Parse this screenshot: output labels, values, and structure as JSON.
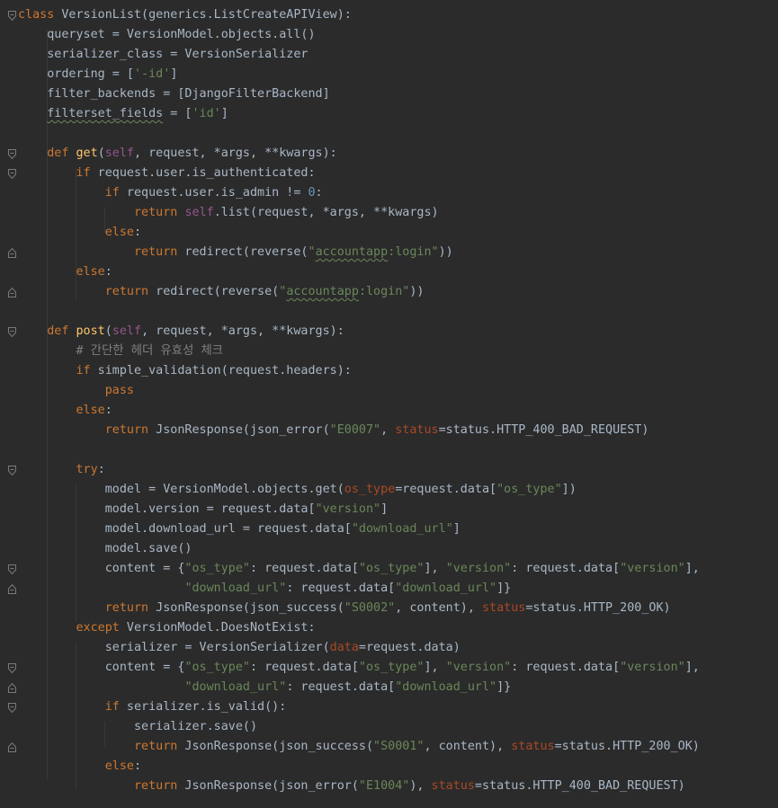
{
  "editor": {
    "language": "python",
    "theme": "darcula",
    "colors": {
      "background": "#2b2b2b",
      "keyword": "#cc7832",
      "function": "#ffc66d",
      "self": "#94558d",
      "string": "#6a8759",
      "number": "#6897bb",
      "comment": "#808080",
      "param": "#aa4926",
      "default": "#a9b7c6"
    },
    "lines": [
      [
        {
          "t": "class",
          "c": "kw"
        },
        {
          "t": " VersionList(generics.ListCreateAPIView):"
        }
      ],
      [
        {
          "t": "    queryset = VersionModel.objects.all()"
        }
      ],
      [
        {
          "t": "    serializer_class = VersionSerializer"
        }
      ],
      [
        {
          "t": "    ordering = ["
        },
        {
          "t": "'-id'",
          "c": "str"
        },
        {
          "t": "]"
        }
      ],
      [
        {
          "t": "    filter_backends = [DjangoFilterBackend]"
        }
      ],
      [
        {
          "t": "    "
        },
        {
          "t": "filterset_fields",
          "c": "wavy-g"
        },
        {
          "t": " = ["
        },
        {
          "t": "'id'",
          "c": "str"
        },
        {
          "t": "]"
        }
      ],
      [],
      [
        {
          "t": "    "
        },
        {
          "t": "def",
          "c": "kw"
        },
        {
          "t": " "
        },
        {
          "t": "get",
          "c": "fn"
        },
        {
          "t": "("
        },
        {
          "t": "self",
          "c": "slf"
        },
        {
          "t": ", request, *args, **kwargs):"
        }
      ],
      [
        {
          "t": "        "
        },
        {
          "t": "if",
          "c": "kw"
        },
        {
          "t": " request.user.is_authenticated:"
        }
      ],
      [
        {
          "t": "            "
        },
        {
          "t": "if",
          "c": "kw"
        },
        {
          "t": " request.user.is_admin != "
        },
        {
          "t": "0",
          "c": "num"
        },
        {
          "t": ":"
        }
      ],
      [
        {
          "t": "                "
        },
        {
          "t": "return",
          "c": "kw"
        },
        {
          "t": " "
        },
        {
          "t": "self",
          "c": "slf"
        },
        {
          "t": ".list(request, *args, **kwargs)"
        }
      ],
      [
        {
          "t": "            "
        },
        {
          "t": "else",
          "c": "kw"
        },
        {
          "t": ":"
        }
      ],
      [
        {
          "t": "                "
        },
        {
          "t": "return",
          "c": "kw"
        },
        {
          "t": " redirect(reverse("
        },
        {
          "t": "\"",
          "c": "str"
        },
        {
          "t": "accountapp",
          "c": "str wavy"
        },
        {
          "t": ":login\"",
          "c": "str"
        },
        {
          "t": "))"
        }
      ],
      [
        {
          "t": "        "
        },
        {
          "t": "else",
          "c": "kw"
        },
        {
          "t": ":"
        }
      ],
      [
        {
          "t": "            "
        },
        {
          "t": "return",
          "c": "kw"
        },
        {
          "t": " redirect(reverse("
        },
        {
          "t": "\"",
          "c": "str"
        },
        {
          "t": "accountapp",
          "c": "str wavy"
        },
        {
          "t": ":login\"",
          "c": "str"
        },
        {
          "t": "))"
        }
      ],
      [],
      [
        {
          "t": "    "
        },
        {
          "t": "def",
          "c": "kw"
        },
        {
          "t": " "
        },
        {
          "t": "post",
          "c": "fn"
        },
        {
          "t": "("
        },
        {
          "t": "self",
          "c": "slf"
        },
        {
          "t": ", request, *args, **kwargs):"
        }
      ],
      [
        {
          "t": "        "
        },
        {
          "t": "# 간단한 헤더 유효성 체크",
          "c": "cm"
        }
      ],
      [
        {
          "t": "        "
        },
        {
          "t": "if",
          "c": "kw"
        },
        {
          "t": " simple_validation(request.headers):"
        }
      ],
      [
        {
          "t": "            "
        },
        {
          "t": "pass",
          "c": "kw"
        }
      ],
      [
        {
          "t": "        "
        },
        {
          "t": "else",
          "c": "kw"
        },
        {
          "t": ":"
        }
      ],
      [
        {
          "t": "            "
        },
        {
          "t": "return",
          "c": "kw"
        },
        {
          "t": " JsonResponse(json_error("
        },
        {
          "t": "\"E0007\"",
          "c": "str"
        },
        {
          "t": ", "
        },
        {
          "t": "status",
          "c": "prm"
        },
        {
          "t": "=status.HTTP_400_BAD_REQUEST)"
        }
      ],
      [],
      [
        {
          "t": "        "
        },
        {
          "t": "try",
          "c": "kw"
        },
        {
          "t": ":"
        }
      ],
      [
        {
          "t": "            model = VersionModel.objects.get("
        },
        {
          "t": "os_type",
          "c": "prm"
        },
        {
          "t": "=request.data["
        },
        {
          "t": "\"os_type\"",
          "c": "str"
        },
        {
          "t": "])"
        }
      ],
      [
        {
          "t": "            model.version = request.data["
        },
        {
          "t": "\"version\"",
          "c": "str"
        },
        {
          "t": "]"
        }
      ],
      [
        {
          "t": "            model.download_url = request.data["
        },
        {
          "t": "\"download_url\"",
          "c": "str"
        },
        {
          "t": "]"
        }
      ],
      [
        {
          "t": "            model.save()"
        }
      ],
      [
        {
          "t": "            content = {"
        },
        {
          "t": "\"os_type\"",
          "c": "str"
        },
        {
          "t": ": request.data["
        },
        {
          "t": "\"os_type\"",
          "c": "str"
        },
        {
          "t": "], "
        },
        {
          "t": "\"version\"",
          "c": "str"
        },
        {
          "t": ": request.data["
        },
        {
          "t": "\"version\"",
          "c": "str"
        },
        {
          "t": "],"
        }
      ],
      [
        {
          "t": "                       "
        },
        {
          "t": "\"download_url\"",
          "c": "str"
        },
        {
          "t": ": request.data["
        },
        {
          "t": "\"download_url\"",
          "c": "str"
        },
        {
          "t": "]}"
        }
      ],
      [
        {
          "t": "            "
        },
        {
          "t": "return",
          "c": "kw"
        },
        {
          "t": " JsonResponse(json_success("
        },
        {
          "t": "\"S0002\"",
          "c": "str"
        },
        {
          "t": ", content), "
        },
        {
          "t": "status",
          "c": "prm"
        },
        {
          "t": "=status.HTTP_200_OK)"
        }
      ],
      [
        {
          "t": "        "
        },
        {
          "t": "except",
          "c": "kw"
        },
        {
          "t": " VersionModel.DoesNotExist:"
        }
      ],
      [
        {
          "t": "            serializer = VersionSerializer("
        },
        {
          "t": "data",
          "c": "prm"
        },
        {
          "t": "=request.data)"
        }
      ],
      [
        {
          "t": "            content = {"
        },
        {
          "t": "\"os_type\"",
          "c": "str"
        },
        {
          "t": ": request.data["
        },
        {
          "t": "\"os_type\"",
          "c": "str"
        },
        {
          "t": "], "
        },
        {
          "t": "\"version\"",
          "c": "str"
        },
        {
          "t": ": request.data["
        },
        {
          "t": "\"version\"",
          "c": "str"
        },
        {
          "t": "],"
        }
      ],
      [
        {
          "t": "                       "
        },
        {
          "t": "\"download_url\"",
          "c": "str"
        },
        {
          "t": ": request.data["
        },
        {
          "t": "\"download_url\"",
          "c": "str"
        },
        {
          "t": "]}"
        }
      ],
      [
        {
          "t": "            "
        },
        {
          "t": "if",
          "c": "kw"
        },
        {
          "t": " serializer.is_valid():"
        }
      ],
      [
        {
          "t": "                serializer.save()"
        }
      ],
      [
        {
          "t": "                "
        },
        {
          "t": "return",
          "c": "kw"
        },
        {
          "t": " JsonResponse(json_success("
        },
        {
          "t": "\"S0001\"",
          "c": "str"
        },
        {
          "t": ", content), "
        },
        {
          "t": "status",
          "c": "prm"
        },
        {
          "t": "=status.HTTP_200_OK)"
        }
      ],
      [
        {
          "t": "            "
        },
        {
          "t": "else",
          "c": "kw"
        },
        {
          "t": ":"
        }
      ],
      [
        {
          "t": "                "
        },
        {
          "t": "return",
          "c": "kw"
        },
        {
          "t": " JsonResponse(json_error("
        },
        {
          "t": "\"E1004\"",
          "c": "str"
        },
        {
          "t": "), "
        },
        {
          "t": "status",
          "c": "prm"
        },
        {
          "t": "=status.HTTP_400_BAD_REQUEST)"
        }
      ]
    ],
    "fold_markers": [
      {
        "line": 0,
        "kind": "open"
      },
      {
        "line": 7,
        "kind": "open"
      },
      {
        "line": 8,
        "kind": "open"
      },
      {
        "line": 12,
        "kind": "close"
      },
      {
        "line": 14,
        "kind": "close"
      },
      {
        "line": 16,
        "kind": "open"
      },
      {
        "line": 23,
        "kind": "open"
      },
      {
        "line": 28,
        "kind": "open"
      },
      {
        "line": 29,
        "kind": "close"
      },
      {
        "line": 33,
        "kind": "open"
      },
      {
        "line": 34,
        "kind": "close"
      },
      {
        "line": 35,
        "kind": "open"
      },
      {
        "line": 37,
        "kind": "close"
      }
    ]
  }
}
